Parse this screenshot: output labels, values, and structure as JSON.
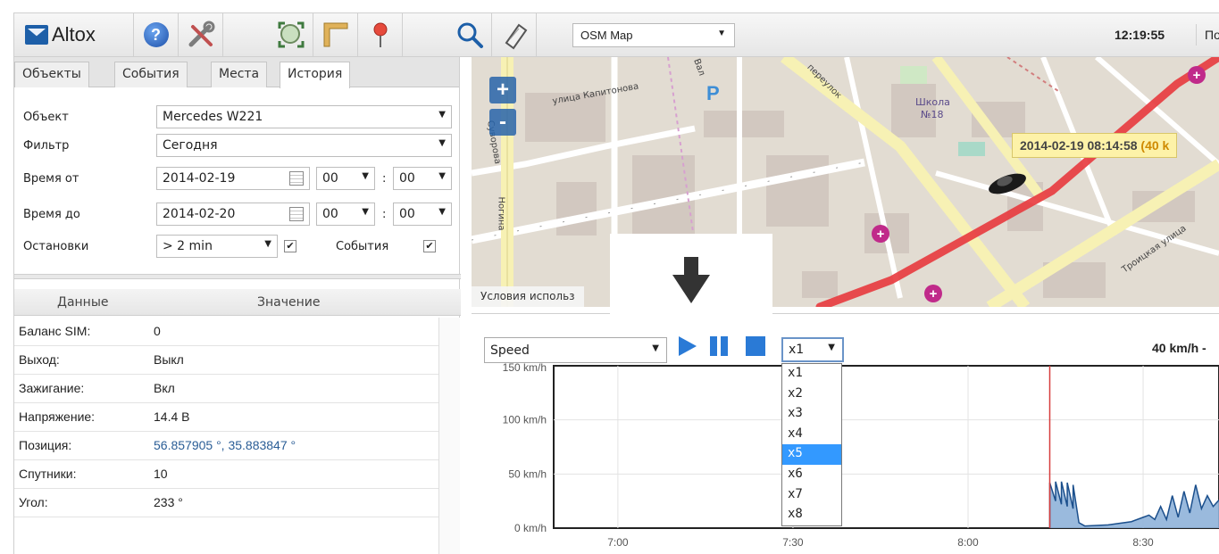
{
  "toolbar": {
    "brand": "Altox",
    "icons": [
      "help-icon",
      "tools-icon",
      "zoom-extent-icon",
      "ruler-icon",
      "map-pin-icon",
      "search-icon",
      "clipboard-icon"
    ],
    "map_layer": "OSM Map",
    "clock": "12:19:55",
    "truncated_label": "По"
  },
  "left": {
    "tabs": [
      "Объекты",
      "События",
      "Места",
      "История"
    ],
    "active_tab": "История",
    "form": {
      "object_label": "Объект",
      "object_value": "Mercedes W221",
      "filter_label": "Фильтр",
      "filter_value": "Сегодня",
      "time_from_label": "Время от",
      "time_from_date": "2014-02-19",
      "time_from_hour": "00",
      "time_from_min": "00",
      "time_to_label": "Время до",
      "time_to_date": "2014-02-20",
      "time_to_hour": "00",
      "time_to_min": "00",
      "stops_label": "Остановки",
      "stops_value": "> 2 min",
      "events_label": "События",
      "colon": ":"
    },
    "grid": {
      "col_data": "Данные",
      "col_value": "Значение",
      "rows": [
        {
          "key": "Баланс SIM:",
          "value": "0"
        },
        {
          "key": "Выход:",
          "value": "Выкл"
        },
        {
          "key": "Зажигание:",
          "value": "Вкл"
        },
        {
          "key": "Напряжение:",
          "value": "14.4 В"
        },
        {
          "key": "Позиция:",
          "value": "56.857905 °, 35.883847 °"
        },
        {
          "key": "Спутники:",
          "value": "10"
        },
        {
          "key": "Угол:",
          "value": "233 °"
        }
      ]
    }
  },
  "map": {
    "zoom_in": "+",
    "zoom_out": "-",
    "tooltip_time": "2014-02-19 08:14:58",
    "tooltip_rest": " (40 k",
    "attribution": "Условия использ",
    "labels": {
      "kapitonova": "улица Капитонова",
      "school": "Школа",
      "school_no": "№18",
      "parking": "P",
      "val": "Вал",
      "pereulok": "переулок",
      "troitskaya": "Троицкая улица",
      "noginа": "Ногина",
      "suvorov": "Суворова"
    },
    "colors": {
      "track": "#e8383d",
      "road": "#f7f1b4",
      "bg": "#e2dcd2"
    }
  },
  "chart_controls": {
    "metric": "Speed",
    "multiplier": "x1",
    "multiplier_options": [
      "x1",
      "x2",
      "x3",
      "x4",
      "x5",
      "x6",
      "x7",
      "x8"
    ],
    "highlighted_option": "x5",
    "readout": "40 km/h -"
  },
  "chart_data": {
    "type": "area",
    "title": "",
    "xlabel": "",
    "ylabel": "",
    "y_ticks": [
      "150 km/h",
      "100 km/h",
      "50 km/h",
      "0 km/h"
    ],
    "x_ticks": [
      "7:00",
      "7:30",
      "8:00",
      "8:30"
    ],
    "ylim": [
      0,
      150
    ],
    "xlim": [
      "6:49",
      "8:43"
    ],
    "cursor": "8:14",
    "series": [
      {
        "values": [
          [
            "8:14",
            0
          ],
          [
            "8:14",
            42
          ],
          [
            "8:15",
            25
          ],
          [
            "8:15",
            43
          ],
          [
            "8:16",
            22
          ],
          [
            "8:16",
            43
          ],
          [
            "8:17",
            20
          ],
          [
            "8:17",
            42
          ],
          [
            "8:18",
            18
          ],
          [
            "8:18",
            40
          ],
          [
            "8:19",
            5
          ],
          [
            "8:20",
            2
          ],
          [
            "8:24",
            3
          ],
          [
            "8:28",
            6
          ],
          [
            "8:30",
            10
          ],
          [
            "8:31",
            12
          ],
          [
            "8:32",
            8
          ],
          [
            "8:33",
            20
          ],
          [
            "8:34",
            8
          ],
          [
            "8:35",
            30
          ],
          [
            "8:36",
            10
          ],
          [
            "8:37",
            34
          ],
          [
            "8:38",
            14
          ],
          [
            "8:39",
            40
          ],
          [
            "8:40",
            18
          ],
          [
            "8:41",
            30
          ],
          [
            "8:42",
            20
          ],
          [
            "8:43",
            26
          ]
        ],
        "color": "#1b4f8c"
      }
    ],
    "grid": true
  }
}
